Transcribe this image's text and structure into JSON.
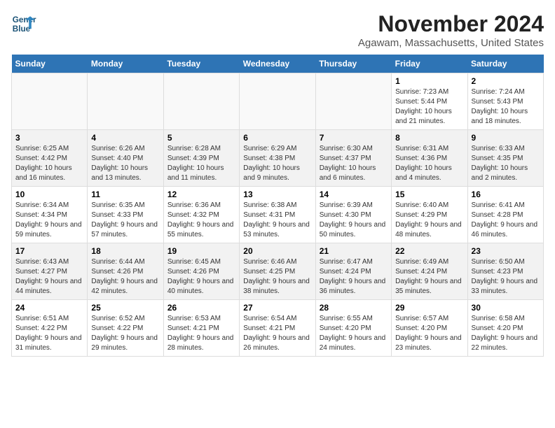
{
  "header": {
    "logo_line1": "General",
    "logo_line2": "Blue",
    "title": "November 2024",
    "subtitle": "Agawam, Massachusetts, United States"
  },
  "weekdays": [
    "Sunday",
    "Monday",
    "Tuesday",
    "Wednesday",
    "Thursday",
    "Friday",
    "Saturday"
  ],
  "weeks": [
    [
      {
        "day": "",
        "info": ""
      },
      {
        "day": "",
        "info": ""
      },
      {
        "day": "",
        "info": ""
      },
      {
        "day": "",
        "info": ""
      },
      {
        "day": "",
        "info": ""
      },
      {
        "day": "1",
        "info": "Sunrise: 7:23 AM\nSunset: 5:44 PM\nDaylight: 10 hours and 21 minutes."
      },
      {
        "day": "2",
        "info": "Sunrise: 7:24 AM\nSunset: 5:43 PM\nDaylight: 10 hours and 18 minutes."
      }
    ],
    [
      {
        "day": "3",
        "info": "Sunrise: 6:25 AM\nSunset: 4:42 PM\nDaylight: 10 hours and 16 minutes."
      },
      {
        "day": "4",
        "info": "Sunrise: 6:26 AM\nSunset: 4:40 PM\nDaylight: 10 hours and 13 minutes."
      },
      {
        "day": "5",
        "info": "Sunrise: 6:28 AM\nSunset: 4:39 PM\nDaylight: 10 hours and 11 minutes."
      },
      {
        "day": "6",
        "info": "Sunrise: 6:29 AM\nSunset: 4:38 PM\nDaylight: 10 hours and 9 minutes."
      },
      {
        "day": "7",
        "info": "Sunrise: 6:30 AM\nSunset: 4:37 PM\nDaylight: 10 hours and 6 minutes."
      },
      {
        "day": "8",
        "info": "Sunrise: 6:31 AM\nSunset: 4:36 PM\nDaylight: 10 hours and 4 minutes."
      },
      {
        "day": "9",
        "info": "Sunrise: 6:33 AM\nSunset: 4:35 PM\nDaylight: 10 hours and 2 minutes."
      }
    ],
    [
      {
        "day": "10",
        "info": "Sunrise: 6:34 AM\nSunset: 4:34 PM\nDaylight: 9 hours and 59 minutes."
      },
      {
        "day": "11",
        "info": "Sunrise: 6:35 AM\nSunset: 4:33 PM\nDaylight: 9 hours and 57 minutes."
      },
      {
        "day": "12",
        "info": "Sunrise: 6:36 AM\nSunset: 4:32 PM\nDaylight: 9 hours and 55 minutes."
      },
      {
        "day": "13",
        "info": "Sunrise: 6:38 AM\nSunset: 4:31 PM\nDaylight: 9 hours and 53 minutes."
      },
      {
        "day": "14",
        "info": "Sunrise: 6:39 AM\nSunset: 4:30 PM\nDaylight: 9 hours and 50 minutes."
      },
      {
        "day": "15",
        "info": "Sunrise: 6:40 AM\nSunset: 4:29 PM\nDaylight: 9 hours and 48 minutes."
      },
      {
        "day": "16",
        "info": "Sunrise: 6:41 AM\nSunset: 4:28 PM\nDaylight: 9 hours and 46 minutes."
      }
    ],
    [
      {
        "day": "17",
        "info": "Sunrise: 6:43 AM\nSunset: 4:27 PM\nDaylight: 9 hours and 44 minutes."
      },
      {
        "day": "18",
        "info": "Sunrise: 6:44 AM\nSunset: 4:26 PM\nDaylight: 9 hours and 42 minutes."
      },
      {
        "day": "19",
        "info": "Sunrise: 6:45 AM\nSunset: 4:26 PM\nDaylight: 9 hours and 40 minutes."
      },
      {
        "day": "20",
        "info": "Sunrise: 6:46 AM\nSunset: 4:25 PM\nDaylight: 9 hours and 38 minutes."
      },
      {
        "day": "21",
        "info": "Sunrise: 6:47 AM\nSunset: 4:24 PM\nDaylight: 9 hours and 36 minutes."
      },
      {
        "day": "22",
        "info": "Sunrise: 6:49 AM\nSunset: 4:24 PM\nDaylight: 9 hours and 35 minutes."
      },
      {
        "day": "23",
        "info": "Sunrise: 6:50 AM\nSunset: 4:23 PM\nDaylight: 9 hours and 33 minutes."
      }
    ],
    [
      {
        "day": "24",
        "info": "Sunrise: 6:51 AM\nSunset: 4:22 PM\nDaylight: 9 hours and 31 minutes."
      },
      {
        "day": "25",
        "info": "Sunrise: 6:52 AM\nSunset: 4:22 PM\nDaylight: 9 hours and 29 minutes."
      },
      {
        "day": "26",
        "info": "Sunrise: 6:53 AM\nSunset: 4:21 PM\nDaylight: 9 hours and 28 minutes."
      },
      {
        "day": "27",
        "info": "Sunrise: 6:54 AM\nSunset: 4:21 PM\nDaylight: 9 hours and 26 minutes."
      },
      {
        "day": "28",
        "info": "Sunrise: 6:55 AM\nSunset: 4:20 PM\nDaylight: 9 hours and 24 minutes."
      },
      {
        "day": "29",
        "info": "Sunrise: 6:57 AM\nSunset: 4:20 PM\nDaylight: 9 hours and 23 minutes."
      },
      {
        "day": "30",
        "info": "Sunrise: 6:58 AM\nSunset: 4:20 PM\nDaylight: 9 hours and 22 minutes."
      }
    ]
  ]
}
